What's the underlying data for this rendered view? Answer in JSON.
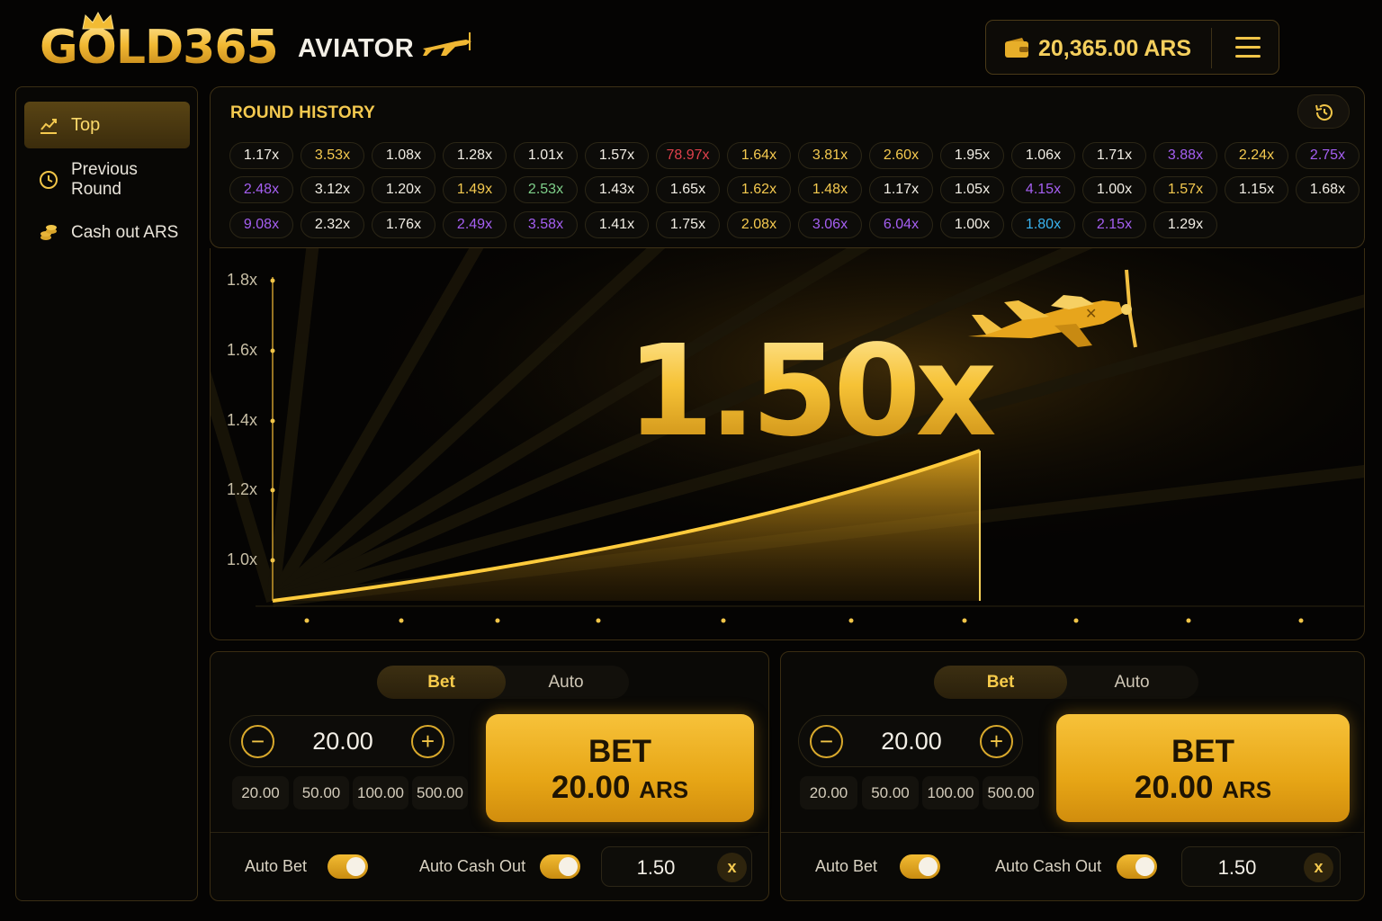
{
  "header": {
    "logo": "GOLD365",
    "game_title": "AVIATOR",
    "balance": "20,365.00 ARS"
  },
  "icons": [
    "crown-icon",
    "plane-icon",
    "wallet-icon",
    "menu-icon",
    "chart-icon",
    "clock-icon",
    "coins-icon",
    "history-icon",
    "minus-icon",
    "plus-icon",
    "close-icon"
  ],
  "colors": {
    "accent": "#f4c94f",
    "red": "#e0414c",
    "purple": "#a55ff2",
    "cyan": "#3ab3f0",
    "green": "#7fd08a",
    "white": "#f1ede4"
  },
  "sidebar": {
    "items": [
      {
        "label": "Top",
        "icon": "chart-icon",
        "active": true
      },
      {
        "label": "Previous Round",
        "icon": "clock-icon",
        "active": false
      },
      {
        "label": "Cash out ARS",
        "icon": "coins-icon",
        "active": false
      }
    ]
  },
  "history": {
    "title": "ROUND HISTORY",
    "rounds": [
      {
        "v": "1.17x",
        "c": "white"
      },
      {
        "v": "3.53x",
        "c": "gold"
      },
      {
        "v": "1.08x",
        "c": "white"
      },
      {
        "v": "1.28x",
        "c": "white"
      },
      {
        "v": "1.01x",
        "c": "white"
      },
      {
        "v": "1.57x",
        "c": "white"
      },
      {
        "v": "78.97x",
        "c": "red"
      },
      {
        "v": "1.64x",
        "c": "gold"
      },
      {
        "v": "3.81x",
        "c": "gold"
      },
      {
        "v": "2.60x",
        "c": "gold"
      },
      {
        "v": "1.95x",
        "c": "white"
      },
      {
        "v": "1.06x",
        "c": "white"
      },
      {
        "v": "1.71x",
        "c": "white"
      },
      {
        "v": "3.88x",
        "c": "purple"
      },
      {
        "v": "2.24x",
        "c": "gold"
      },
      {
        "v": "2.75x",
        "c": "purple"
      },
      {
        "v": "2.48x",
        "c": "purple"
      },
      {
        "v": "3.12x",
        "c": "white"
      },
      {
        "v": "1.20x",
        "c": "white"
      },
      {
        "v": "1.49x",
        "c": "gold"
      },
      {
        "v": "2.53x",
        "c": "green"
      },
      {
        "v": "1.43x",
        "c": "white"
      },
      {
        "v": "1.65x",
        "c": "white"
      },
      {
        "v": "1.62x",
        "c": "gold"
      },
      {
        "v": "1.48x",
        "c": "gold"
      },
      {
        "v": "1.17x",
        "c": "white"
      },
      {
        "v": "1.05x",
        "c": "white"
      },
      {
        "v": "4.15x",
        "c": "purple"
      },
      {
        "v": "1.00x",
        "c": "white"
      },
      {
        "v": "1.57x",
        "c": "gold"
      },
      {
        "v": "1.15x",
        "c": "white"
      },
      {
        "v": "1.68x",
        "c": "white"
      },
      {
        "v": "9.08x",
        "c": "purple"
      },
      {
        "v": "2.32x",
        "c": "white"
      },
      {
        "v": "1.76x",
        "c": "white"
      },
      {
        "v": "2.49x",
        "c": "purple"
      },
      {
        "v": "3.58x",
        "c": "purple"
      },
      {
        "v": "1.41x",
        "c": "white"
      },
      {
        "v": "1.75x",
        "c": "white"
      },
      {
        "v": "2.08x",
        "c": "gold"
      },
      {
        "v": "3.06x",
        "c": "purple"
      },
      {
        "v": "6.04x",
        "c": "purple"
      },
      {
        "v": "1.00x",
        "c": "white"
      },
      {
        "v": "1.80x",
        "c": "cyan"
      },
      {
        "v": "2.15x",
        "c": "purple"
      },
      {
        "v": "1.29x",
        "c": "white"
      }
    ]
  },
  "game": {
    "multiplier": "1.50x",
    "y_ticks": [
      "1.8x",
      "1.6x",
      "1.4x",
      "1.2x",
      "1.0x"
    ]
  },
  "bet_panels": [
    {
      "tabs": [
        "Bet",
        "Auto"
      ],
      "active_tab": "Bet",
      "amount": "20.00",
      "presets": [
        "20.00",
        "50.00",
        "100.00",
        "500.00"
      ],
      "bet_label": "BET",
      "bet_amount": "20.00",
      "bet_currency": "ARS",
      "auto_bet_label": "Auto Bet",
      "auto_bet_on": true,
      "auto_cashout_label": "Auto Cash Out",
      "auto_cashout_on": true,
      "cashout_value": "1.50",
      "clear_label": "x"
    },
    {
      "tabs": [
        "Bet",
        "Auto"
      ],
      "active_tab": "Bet",
      "amount": "20.00",
      "presets": [
        "20.00",
        "50.00",
        "100.00",
        "500.00"
      ],
      "bet_label": "BET",
      "bet_amount": "20.00",
      "bet_currency": "ARS",
      "auto_bet_label": "Auto Bet",
      "auto_bet_on": true,
      "auto_cashout_label": "Auto Cash Out",
      "auto_cashout_on": true,
      "cashout_value": "1.50",
      "clear_label": "x"
    }
  ]
}
